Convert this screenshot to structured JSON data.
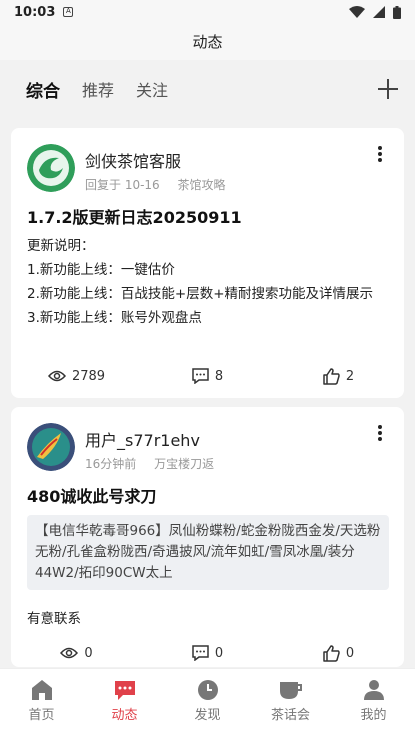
{
  "status": {
    "time": "10:03",
    "sim_icon": "sim-card-icon"
  },
  "header": {
    "title": "动态"
  },
  "tabs": [
    {
      "label": "综合",
      "active": true
    },
    {
      "label": "推荐",
      "active": false
    },
    {
      "label": "关注",
      "active": false
    }
  ],
  "posts": [
    {
      "author": "剑侠茶馆客服",
      "time": "回复于 10-16",
      "category": "茶馆攻略",
      "title": "1.7.2版更新日志20250911",
      "lines": [
        "更新说明：",
        "1.新功能上线：一键估价",
        "2.新功能上线：百战技能+层数+精耐搜索功能及详情展示",
        "3.新功能上线：账号外观盘点"
      ],
      "views": "2789",
      "comments": "8",
      "likes": "2"
    },
    {
      "author": "用户_s77r1ehv",
      "time": "16分钟前",
      "category": "万宝楼刀返",
      "title": "480诚收此号求刀",
      "quote": "【电信华乾毒哥966】凤仙粉蝶粉/蛇金粉陇西金发/天选粉无粉/孔雀盒粉陇西/奇遇披风/流年如虹/雪凤冰凰/装分44W2/拓印90CW太上",
      "after": "有意联系",
      "views": "0",
      "comments": "0",
      "likes": "0"
    }
  ],
  "nav": [
    {
      "label": "首页",
      "icon": "home-icon",
      "active": false
    },
    {
      "label": "动态",
      "icon": "chat-icon",
      "active": true
    },
    {
      "label": "发现",
      "icon": "clock-icon",
      "active": false
    },
    {
      "label": "茶话会",
      "icon": "cup-icon",
      "active": false
    },
    {
      "label": "我的",
      "icon": "user-icon",
      "active": false
    }
  ],
  "colors": {
    "accent": "#e0414a",
    "background": "#f2f2f2"
  }
}
